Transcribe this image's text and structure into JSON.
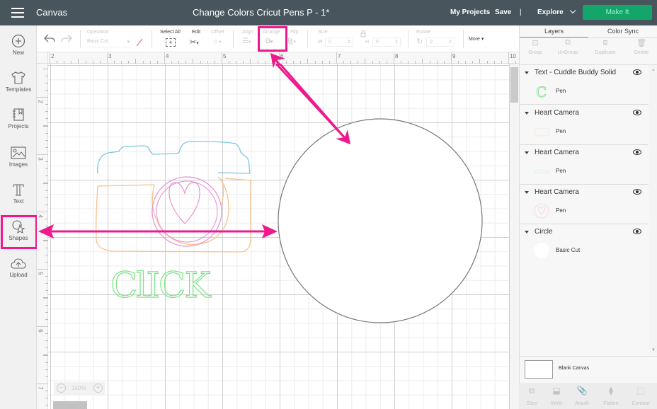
{
  "topbar": {
    "app_title": "Canvas",
    "document_title": "Change Colors Cricut Pens P - 1*",
    "my_projects": "My Projects",
    "save": "Save",
    "divider": "|",
    "explore": "Explore",
    "make_it": "Make It"
  },
  "sidebar": {
    "items": [
      {
        "label": "New",
        "icon": "plus-circle-icon"
      },
      {
        "label": "Templates",
        "icon": "tshirt-icon"
      },
      {
        "label": "Projects",
        "icon": "notebook-icon"
      },
      {
        "label": "Images",
        "icon": "image-icon"
      },
      {
        "label": "Text",
        "icon": "text-icon"
      },
      {
        "label": "Shapes",
        "icon": "shapes-icon",
        "highlighted": true
      },
      {
        "label": "Upload",
        "icon": "cloud-upload-icon"
      }
    ]
  },
  "toolbar": {
    "operation_label": "Operation",
    "operation_value": "Basic Cut",
    "select_all": "Select All",
    "edit": "Edit",
    "offset": "Offset",
    "align": "Align",
    "arrange": "Arrange",
    "flip": "Flip",
    "size": "Size",
    "w_label": "W",
    "w_value": "0",
    "h_label": "H",
    "h_value": "0",
    "rotate": "Rotate",
    "rotate_value": "0",
    "more": "More"
  },
  "rulers": {
    "horizontal": [
      "2",
      "3",
      "4",
      "5",
      "6",
      "7",
      "8",
      "9",
      "10"
    ],
    "vertical": [
      "2",
      "3",
      "4",
      "5",
      "6",
      "7"
    ]
  },
  "canvas": {
    "zoom_level": "150%",
    "text_object": "ClICK",
    "colors": {
      "camera_top": "#7cc6e0",
      "camera_body": "#f7c28e",
      "camera_lens": "#e891d2",
      "text": "#7ee28a",
      "circle_stroke": "#777777",
      "annotation": "#ee1a8c"
    }
  },
  "panel": {
    "tabs": [
      "Layers",
      "Color Sync"
    ],
    "actions": [
      "Group",
      "UnGroup",
      "Duplicate",
      "Delete"
    ],
    "layers": [
      {
        "name": "Text - Cuddle Buddy Solid",
        "operation": "Pen"
      },
      {
        "name": "Heart Camera",
        "operation": "Pen"
      },
      {
        "name": "Heart Camera",
        "operation": "Pen"
      },
      {
        "name": "Heart Camera",
        "operation": "Pen"
      },
      {
        "name": "Circle",
        "operation": "Basic Cut"
      }
    ],
    "blank_canvas": "Blank Canvas",
    "bottom_actions": [
      "Slice",
      "Weld",
      "Attach",
      "Flatten",
      "Contour"
    ]
  }
}
